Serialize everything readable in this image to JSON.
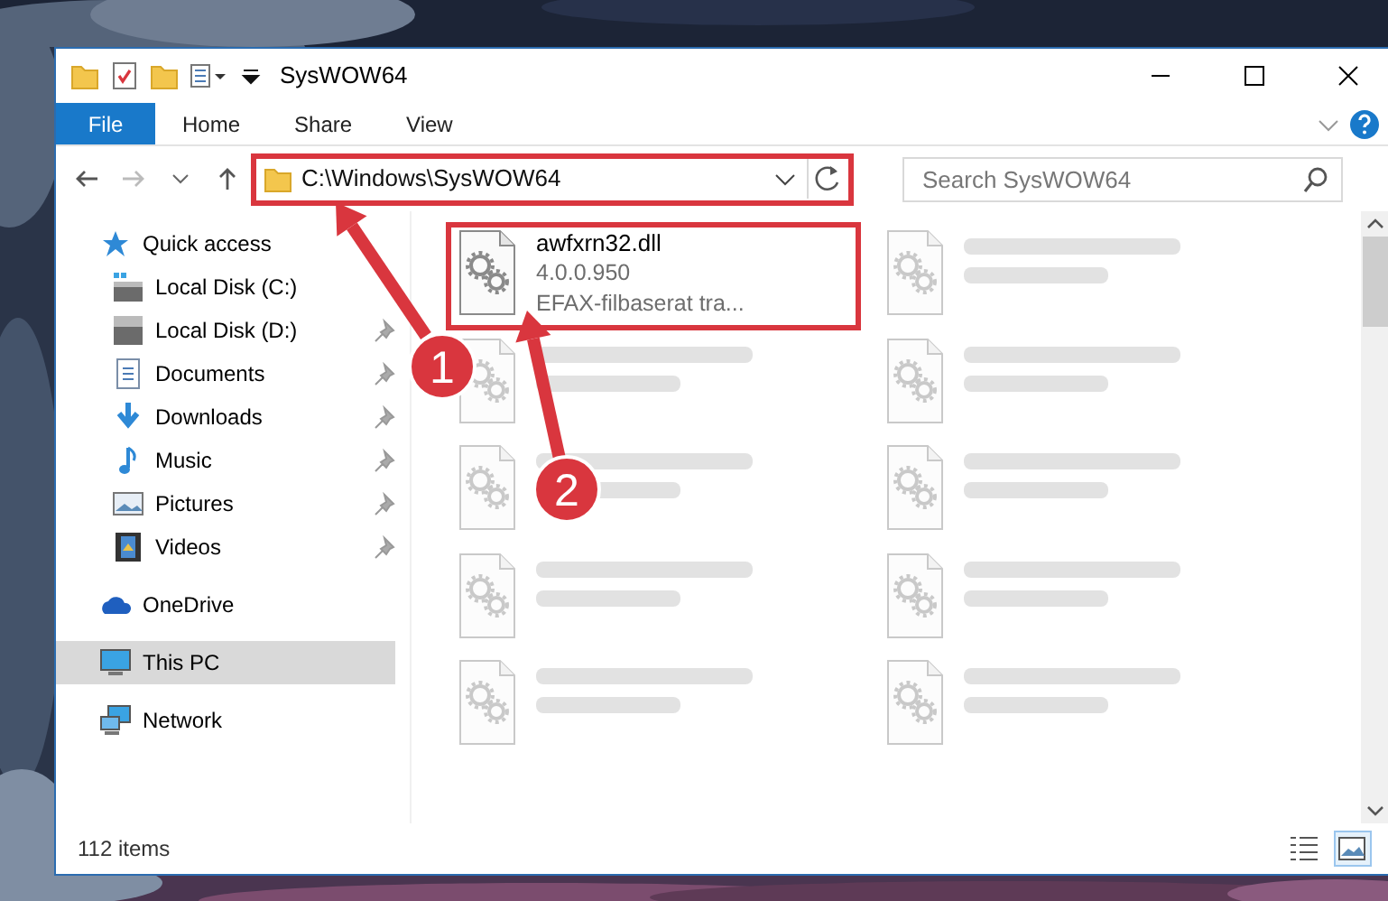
{
  "window": {
    "title": "SysWOW64"
  },
  "ribbon_tabs": [
    {
      "label": "File",
      "kind": "file",
      "selected": false
    },
    {
      "label": "Home",
      "kind": "tab",
      "selected": false
    },
    {
      "label": "Share",
      "kind": "tab",
      "selected": false
    },
    {
      "label": "View",
      "kind": "tab",
      "selected": false
    }
  ],
  "address_bar": {
    "path": "C:\\Windows\\SysWOW64",
    "highlighted": true
  },
  "search": {
    "placeholder": "Search SysWOW64"
  },
  "sidebar": {
    "items": [
      {
        "label": "Quick access",
        "kind": "star",
        "selected": false,
        "children": [
          {
            "label": "Local Disk (C:)",
            "kind": "drive-c",
            "pinned": false,
            "selected": false
          },
          {
            "label": "Local Disk (D:)",
            "kind": "drive",
            "pinned": true,
            "selected": false
          },
          {
            "label": "Documents",
            "kind": "document",
            "pinned": true,
            "selected": false
          },
          {
            "label": "Downloads",
            "kind": "download",
            "pinned": true,
            "selected": false
          },
          {
            "label": "Music",
            "kind": "music",
            "pinned": true,
            "selected": false
          },
          {
            "label": "Pictures",
            "kind": "pictures",
            "pinned": true,
            "selected": false
          },
          {
            "label": "Videos",
            "kind": "video",
            "pinned": true,
            "selected": false
          }
        ]
      },
      {
        "label": "OneDrive",
        "kind": "cloud",
        "selected": false
      },
      {
        "label": "This PC",
        "kind": "pc",
        "selected": true
      },
      {
        "label": "Network",
        "kind": "network",
        "selected": false
      }
    ]
  },
  "files": [
    {
      "kind": "file",
      "name": "awfxrn32.dll",
      "details": [
        "4.0.0.950",
        "EFAX-filbaserat tra..."
      ],
      "highlighted": true
    },
    {
      "kind": "blurred"
    },
    {
      "kind": "blurred"
    },
    {
      "kind": "blurred"
    },
    {
      "kind": "blurred"
    },
    {
      "kind": "blurred"
    },
    {
      "kind": "blurred"
    },
    {
      "kind": "blurred"
    },
    {
      "kind": "blurred"
    },
    {
      "kind": "blurred"
    }
  ],
  "status_bar": {
    "count": "112 items"
  },
  "view_buttons": [
    {
      "kind": "details",
      "selected": false
    },
    {
      "kind": "large-icons",
      "selected": true
    }
  ],
  "annotations": [
    {
      "number": "1"
    },
    {
      "number": "2"
    }
  ]
}
